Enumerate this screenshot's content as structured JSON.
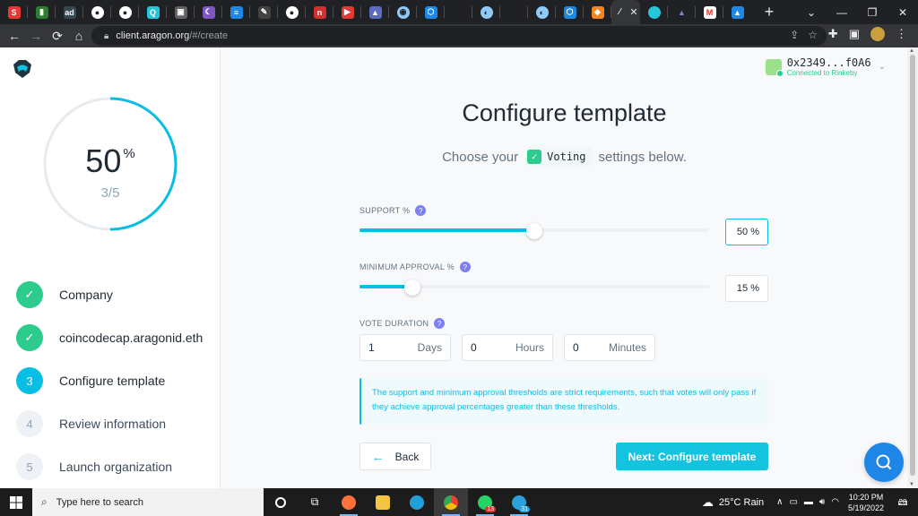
{
  "browser": {
    "tabs": [
      {
        "icon": "s-icon",
        "color": "#e53935",
        "glyph": "S"
      },
      {
        "icon": "chart-icon",
        "color": "#2e7d32",
        "glyph": "▮"
      },
      {
        "icon": "ad-icon",
        "color": "#37474f",
        "glyph": "ad"
      },
      {
        "icon": "globe-icon",
        "color": "#ffffff",
        "glyph": "●"
      },
      {
        "icon": "globe-icon",
        "color": "#ffffff",
        "glyph": "●"
      },
      {
        "icon": "q-icon",
        "color": "#26c6da",
        "glyph": "Q"
      },
      {
        "icon": "reader-icon",
        "color": "#616161",
        "glyph": "▣"
      },
      {
        "icon": "moon-icon",
        "color": "#7e57c2",
        "glyph": "☾"
      },
      {
        "icon": "doc-icon",
        "color": "#1e88e5",
        "glyph": "≡"
      },
      {
        "icon": "pen-icon",
        "color": "#424242",
        "glyph": "✎"
      },
      {
        "icon": "globe-icon",
        "color": "#ffffff",
        "glyph": "●"
      },
      {
        "icon": "n-icon",
        "color": "#d32f2f",
        "glyph": "n"
      },
      {
        "icon": "youtube-icon",
        "color": "#e53935",
        "glyph": "▶"
      },
      {
        "icon": "triangle-icon",
        "color": "#5c6bc0",
        "glyph": "▲"
      },
      {
        "icon": "ring-icon",
        "color": "#90caf9",
        "glyph": "◉"
      },
      {
        "icon": "hex-icon",
        "color": "#1e88e5",
        "glyph": "⬡"
      },
      {
        "icon": "blank-icon",
        "color": "#202124",
        "glyph": ""
      },
      {
        "icon": "ring-icon",
        "color": "#90caf9",
        "glyph": "◐"
      },
      {
        "icon": "blank-icon",
        "color": "#202124",
        "glyph": ""
      },
      {
        "icon": "ring-icon",
        "color": "#90caf9",
        "glyph": "◐"
      },
      {
        "icon": "hex-icon",
        "color": "#1e88e5",
        "glyph": "⬡"
      },
      {
        "icon": "fox-icon",
        "color": "#f6851b",
        "glyph": "◆"
      }
    ],
    "active_tab_close": "✕",
    "new_tab": "+",
    "url_host": "client.aragon.org",
    "url_path": "/#/create"
  },
  "account": {
    "address": "0x2349...f0A6",
    "network": "Connected to Rinkeby"
  },
  "progress": {
    "percent": "50",
    "percent_sign": "%",
    "fraction": 0.5,
    "count": "3/5"
  },
  "steps": [
    {
      "number": "",
      "label": "Company",
      "state": "done"
    },
    {
      "number": "",
      "label": "coincodecap.aragonid.eth",
      "state": "done"
    },
    {
      "number": "3",
      "label": "Configure template",
      "state": "current"
    },
    {
      "number": "4",
      "label": "Review information",
      "state": "todo"
    },
    {
      "number": "5",
      "label": "Launch organization",
      "state": "todo"
    }
  ],
  "main": {
    "title": "Configure template",
    "subtitle_before": "Choose your",
    "app_name": "Voting",
    "subtitle_after": "settings below."
  },
  "support": {
    "label": "SUPPORT %",
    "value": "50 %",
    "fraction": 0.5
  },
  "min_approval": {
    "label": "MINIMUM APPROVAL %",
    "value": "15 %",
    "fraction": 0.15
  },
  "duration": {
    "label": "VOTE DURATION",
    "days_value": "1",
    "days_unit": "Days",
    "hours_value": "0",
    "hours_unit": "Hours",
    "minutes_value": "0",
    "minutes_unit": "Minutes"
  },
  "info_text": "The support and minimum approval thresholds are strict requirements, such that votes will only pass if they achieve approval percentages greater than these thresholds.",
  "buttons": {
    "back": "Back",
    "next": "Next: Configure template"
  },
  "help_glyph": "?",
  "taskbar": {
    "search_placeholder": "Type here to search",
    "whatsapp_badge": "13",
    "telegram_badge": "31",
    "weather": "25°C  Rain",
    "time": "10:20 PM",
    "date": "5/19/2022",
    "notifications": "28"
  },
  "colors": {
    "accent": "#08bee5",
    "done": "#2ccb8e",
    "help": "#7c80f2"
  }
}
